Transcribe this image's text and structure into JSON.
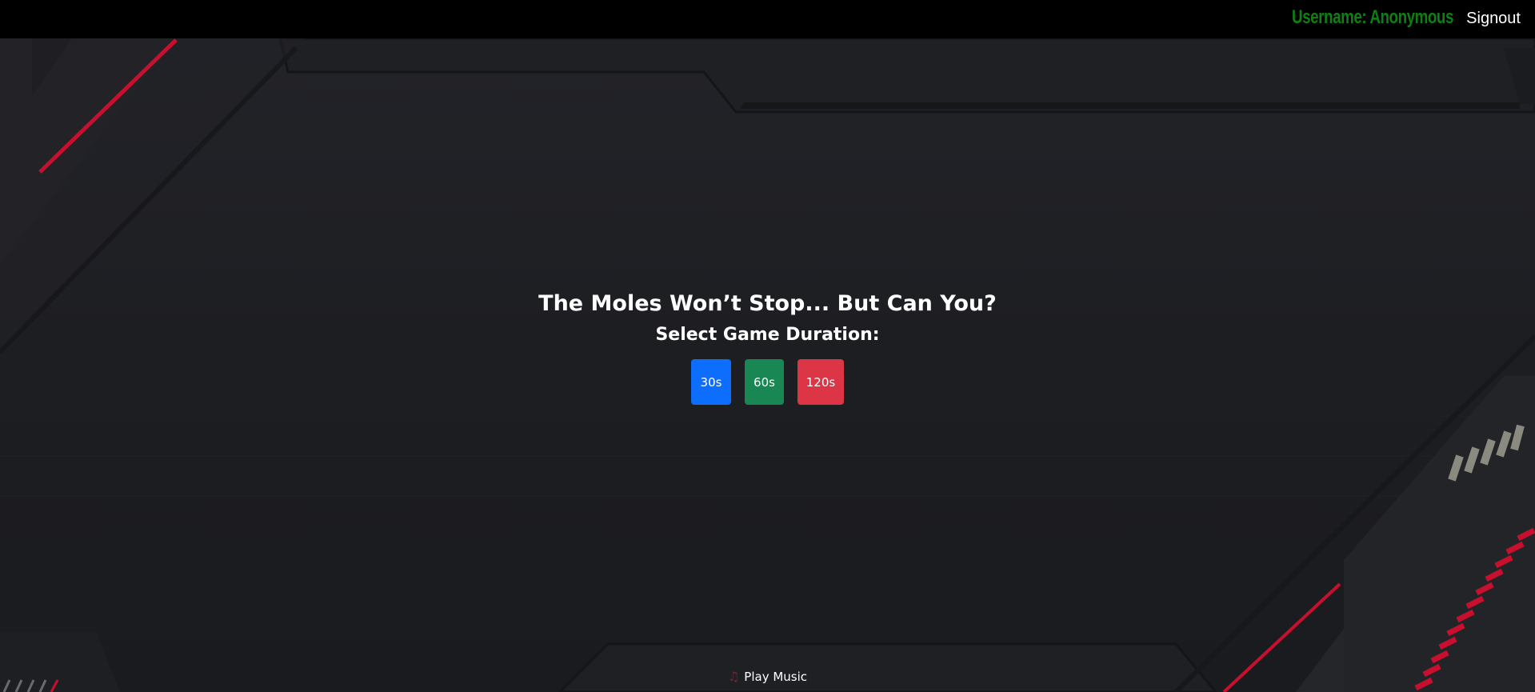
{
  "header": {
    "username_text": "Username: Anonymous",
    "signout_label": "Signout"
  },
  "main": {
    "headline": "The Moles Won’t Stop... But Can You?",
    "subtitle": "Select Game Duration:",
    "durations": [
      {
        "label": "30s",
        "color": "#0d6efd"
      },
      {
        "label": "60s",
        "color": "#198754"
      },
      {
        "label": "120s",
        "color": "#dc3545"
      }
    ]
  },
  "footer": {
    "music_icon": "music-note-icon",
    "music_label": "Play Music"
  },
  "colors": {
    "username": "#0e7f13",
    "topbar": "#000000",
    "background": "#1b1c20",
    "accent_red": "#c8102e"
  }
}
